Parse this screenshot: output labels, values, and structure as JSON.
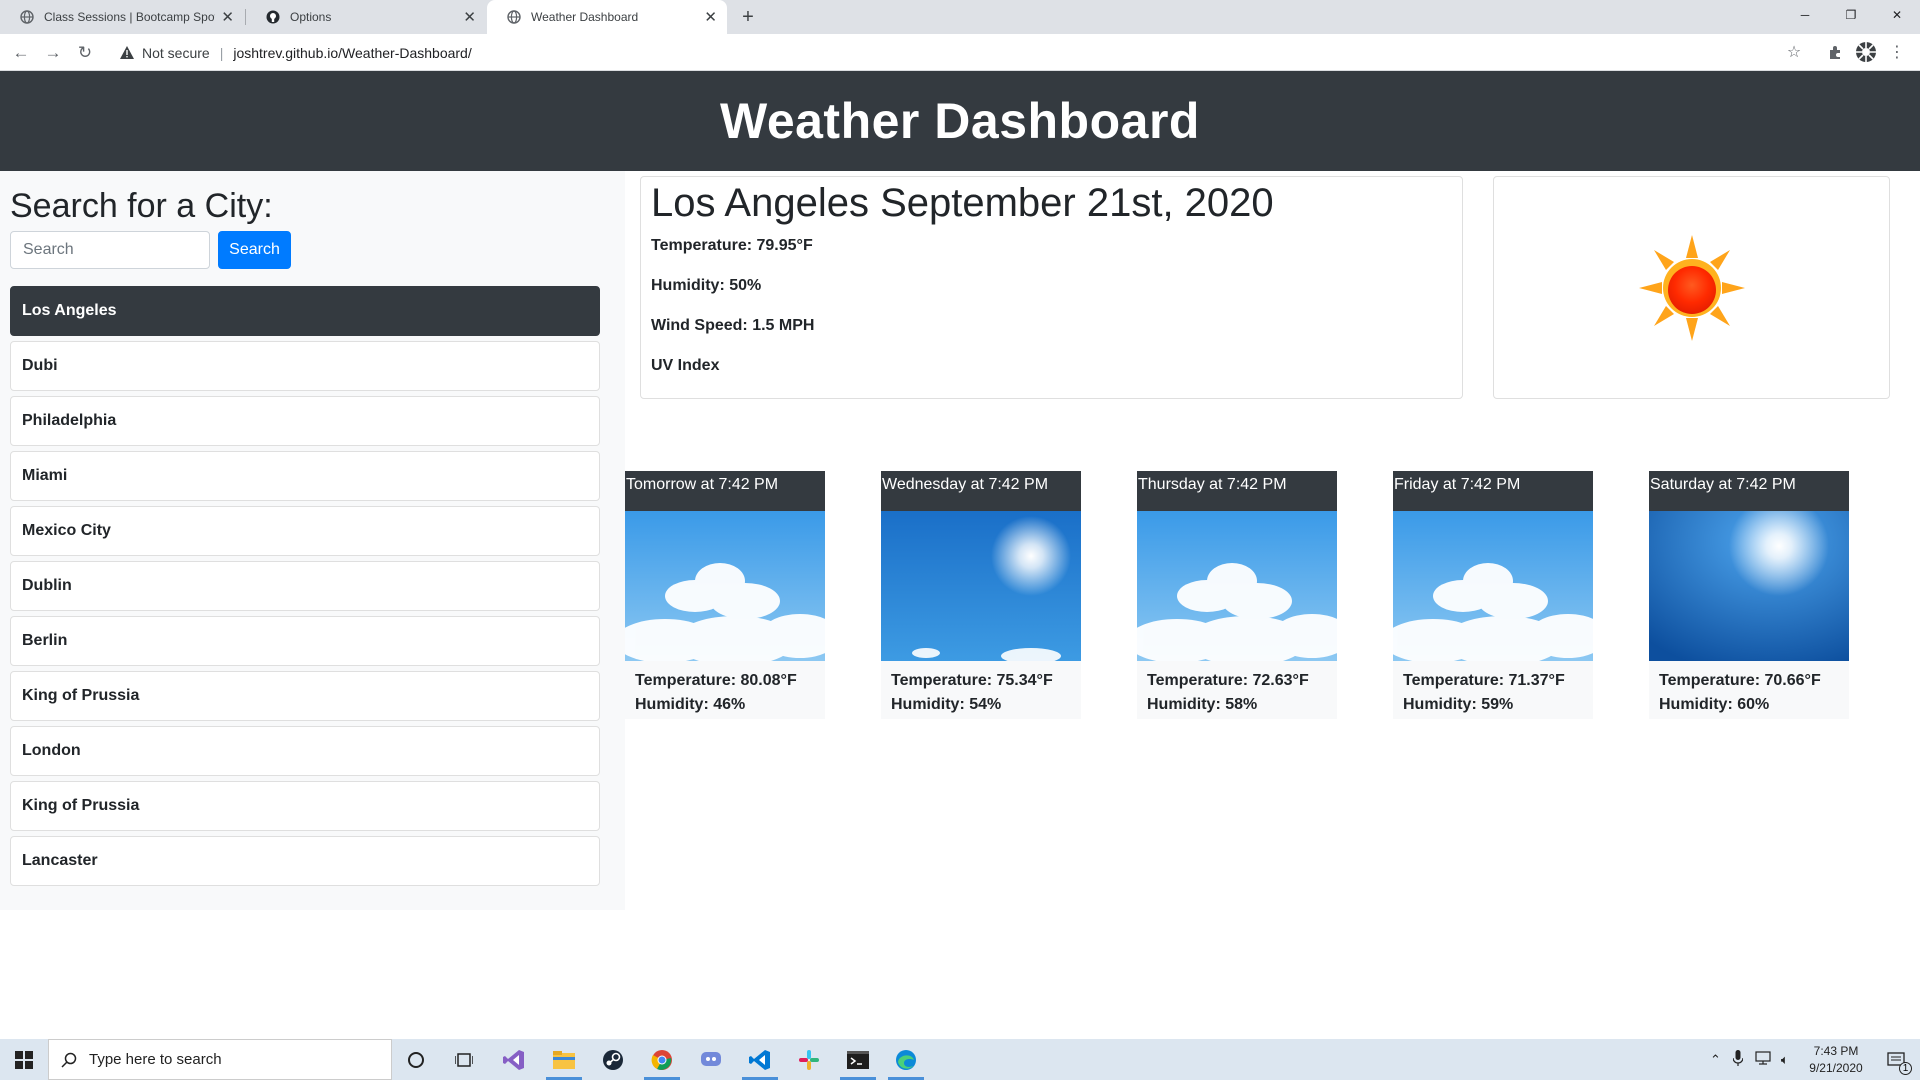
{
  "browser": {
    "tabs": [
      {
        "title": "Class Sessions | Bootcamp Spot",
        "icon": "globe-icon",
        "active": false
      },
      {
        "title": "Options",
        "icon": "github-icon",
        "active": false
      },
      {
        "title": "Weather Dashboard",
        "icon": "globe-icon",
        "active": true
      }
    ],
    "security_label": "Not secure",
    "url": "joshtrev.github.io/Weather-Dashboard/"
  },
  "page": {
    "header_title": "Weather Dashboard",
    "search": {
      "heading": "Search for a City:",
      "placeholder": "Search",
      "button_label": "Search"
    },
    "cities": [
      {
        "name": "Los Angeles",
        "active": true
      },
      {
        "name": "Dubi",
        "active": false
      },
      {
        "name": "Philadelphia",
        "active": false
      },
      {
        "name": "Miami",
        "active": false
      },
      {
        "name": "Mexico City",
        "active": false
      },
      {
        "name": "Dublin",
        "active": false
      },
      {
        "name": "Berlin",
        "active": false
      },
      {
        "name": "King of Prussia",
        "active": false
      },
      {
        "name": "London",
        "active": false
      },
      {
        "name": "King of Prussia",
        "active": false
      },
      {
        "name": "Lancaster",
        "active": false
      }
    ],
    "current": {
      "title": "Los Angeles September 21st, 2020",
      "temperature": "Temperature: 79.95°F",
      "humidity": "Humidity: 50%",
      "wind": "Wind Speed: 1.5 MPH",
      "uv": "UV Index",
      "icon": "sun-icon"
    },
    "forecast": [
      {
        "label": "Tomorrow at 7:42 PM",
        "temperature": "Temperature: 80.08°F",
        "humidity": "Humidity: 46%",
        "image": "sky-clouds"
      },
      {
        "label": "Wednesday at 7:42 PM",
        "temperature": "Temperature: 75.34°F",
        "humidity": "Humidity: 54%",
        "image": "sky-sun"
      },
      {
        "label": "Thursday at 7:42 PM",
        "temperature": "Temperature: 72.63°F",
        "humidity": "Humidity: 58%",
        "image": "sky-clouds"
      },
      {
        "label": "Friday at 7:42 PM",
        "temperature": "Temperature: 71.37°F",
        "humidity": "Humidity: 59%",
        "image": "sky-clouds"
      },
      {
        "label": "Saturday at 7:42 PM",
        "temperature": "Temperature: 70.66°F",
        "humidity": "Humidity: 60%",
        "image": "sky-sun"
      }
    ]
  },
  "taskbar": {
    "search_placeholder": "Type here to search",
    "time": "7:43 PM",
    "date": "9/21/2020",
    "notification_count": "1"
  }
}
